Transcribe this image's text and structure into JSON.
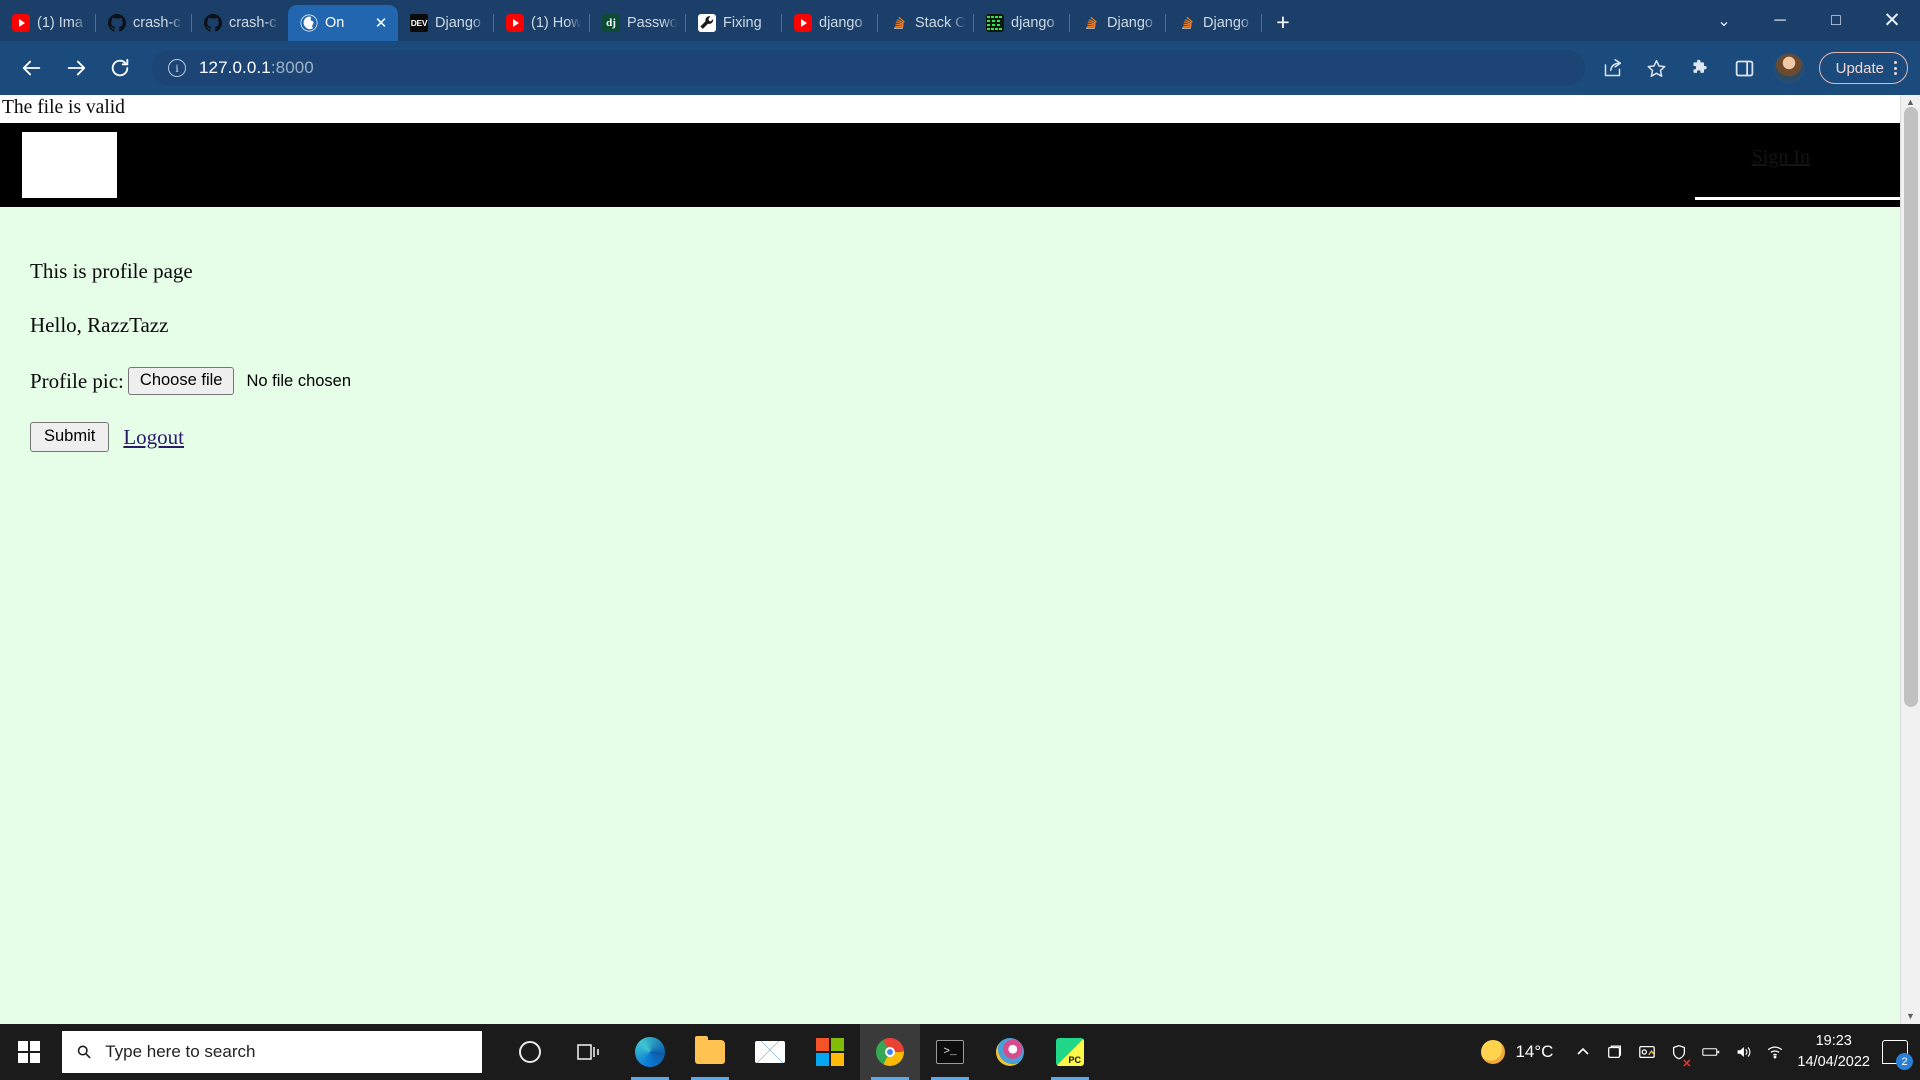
{
  "browser": {
    "tabs": [
      {
        "title": "(1) Ima",
        "favicon": "youtube-icon",
        "active": false
      },
      {
        "title": "crash-c",
        "favicon": "github-icon",
        "active": false
      },
      {
        "title": "crash-c",
        "favicon": "github-icon",
        "active": false
      },
      {
        "title": "On",
        "favicon": "chrome-globe-icon",
        "active": true
      },
      {
        "title": "Django",
        "favicon": "devto-icon",
        "active": false
      },
      {
        "title": "(1) How",
        "favicon": "youtube-icon",
        "active": false
      },
      {
        "title": "Passwo",
        "favicon": "django-dj-icon",
        "active": false
      },
      {
        "title": "Fixing",
        "favicon": "wrench-icon",
        "active": false
      },
      {
        "title": "django",
        "favicon": "youtube-icon",
        "active": false
      },
      {
        "title": "Stack O",
        "favicon": "stackoverflow-icon",
        "active": false
      },
      {
        "title": "django",
        "favicon": "matrix-icon",
        "active": false
      },
      {
        "title": "Django",
        "favicon": "stackoverflow-icon",
        "active": false
      },
      {
        "title": "Django",
        "favicon": "stackoverflow-icon",
        "active": false
      }
    ],
    "new_tab_label": "+",
    "close_tab_label": "✕",
    "window_controls": {
      "expand": "⌄",
      "minimize": "─",
      "maximize": "□",
      "close": "✕"
    },
    "toolbar": {
      "back_label": "back-arrow",
      "forward_label": "forward-arrow",
      "reload_label": "reload",
      "site_info_label": "ⓘ",
      "url_host": "127.0.0.1",
      "url_port": ":8000",
      "url_full": "127.0.0.1:8000",
      "update_label": "Update",
      "share_label": "share-icon",
      "bookmark_label": "star-icon",
      "extensions_label": "puzzle-icon",
      "collections_label": "sidebar-icon"
    }
  },
  "page": {
    "flash_message": "The file is valid",
    "navbar": {
      "sign_in_label": "Sign In"
    },
    "heading": "This is profile page",
    "greeting": "Hello, RazzTazz",
    "form": {
      "file_label": "Profile pic:",
      "choose_file_button": "Choose file",
      "file_status": "No file chosen",
      "submit_button": "Submit",
      "logout_link": "Logout"
    },
    "background_color": "#e6fde8"
  },
  "taskbar": {
    "search_placeholder": "Type here to search",
    "apps": [
      {
        "name": "cortana",
        "label": "Cortana"
      },
      {
        "name": "task-view",
        "label": "Task View"
      },
      {
        "name": "edge",
        "label": "Microsoft Edge"
      },
      {
        "name": "file-explorer",
        "label": "File Explorer"
      },
      {
        "name": "mail",
        "label": "Mail"
      },
      {
        "name": "microsoft-store",
        "label": "Microsoft Store"
      },
      {
        "name": "chrome",
        "label": "Google Chrome"
      },
      {
        "name": "terminal",
        "label": "Command Prompt"
      },
      {
        "name": "paint",
        "label": "Paint 3D"
      },
      {
        "name": "pycharm",
        "label": "PyCharm"
      }
    ],
    "weather_temp": "14°C",
    "time": "19:23",
    "date": "14/04/2022",
    "notification_count": "2"
  }
}
